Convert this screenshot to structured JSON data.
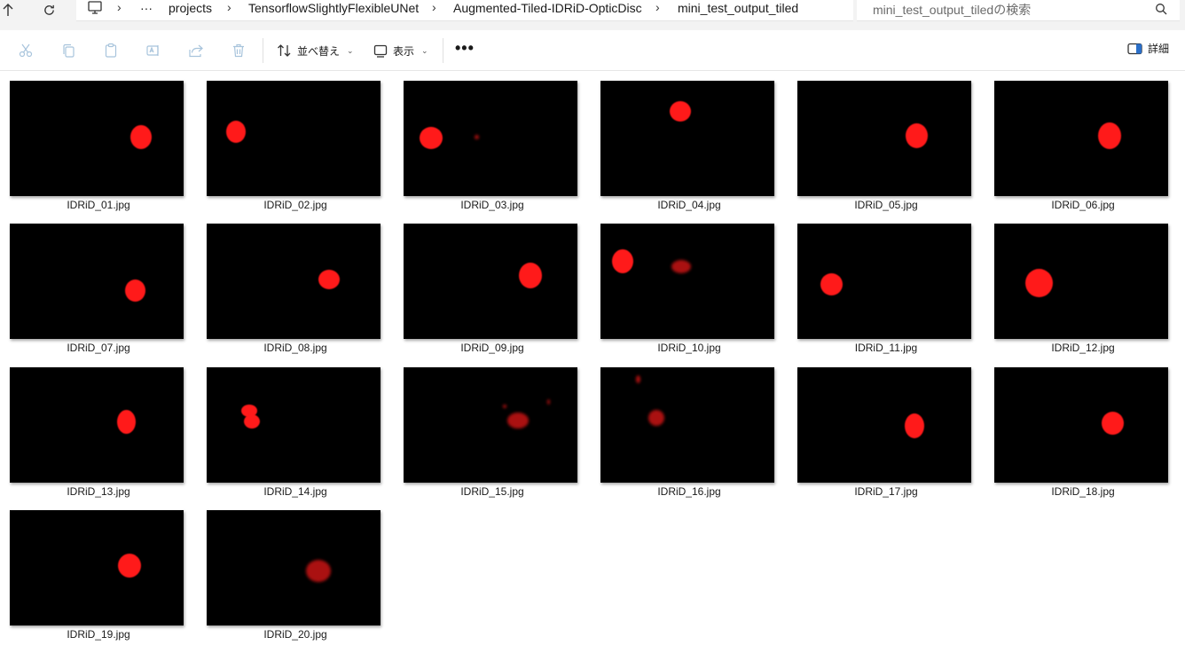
{
  "address": {
    "crumbs": [
      "projects",
      "TensorflowSlightlyFlexibleUNet",
      "Augmented-Tiled-IDRiD-OpticDisc",
      "mini_test_output_tiled"
    ],
    "more_label": "···"
  },
  "search": {
    "placeholder": "mini_test_output_tiledの検索"
  },
  "toolbar": {
    "sort_label": "並べ替え",
    "view_label": "表示",
    "more_label": "•••",
    "details_label": "詳細",
    "icons": [
      "cut-icon",
      "copy-icon",
      "paste-icon",
      "rename-icon",
      "share-icon",
      "delete-icon"
    ]
  },
  "files": [
    {
      "name": "IDRiD_01.jpg"
    },
    {
      "name": "IDRiD_02.jpg"
    },
    {
      "name": "IDRiD_03.jpg"
    },
    {
      "name": "IDRiD_04.jpg"
    },
    {
      "name": "IDRiD_05.jpg"
    },
    {
      "name": "IDRiD_06.jpg"
    },
    {
      "name": "IDRiD_07.jpg"
    },
    {
      "name": "IDRiD_08.jpg"
    },
    {
      "name": "IDRiD_09.jpg"
    },
    {
      "name": "IDRiD_10.jpg"
    },
    {
      "name": "IDRiD_11.jpg"
    },
    {
      "name": "IDRiD_12.jpg"
    },
    {
      "name": "IDRiD_13.jpg"
    },
    {
      "name": "IDRiD_14.jpg"
    },
    {
      "name": "IDRiD_15.jpg"
    },
    {
      "name": "IDRiD_16.jpg"
    },
    {
      "name": "IDRiD_17.jpg"
    },
    {
      "name": "IDRiD_18.jpg"
    },
    {
      "name": "IDRiD_19.jpg"
    },
    {
      "name": "IDRiD_20.jpg"
    }
  ],
  "colors": {
    "mask_red": "#ff1a1a",
    "thumb_bg": "#000000",
    "toolbar_bg": "#ffffff",
    "address_bg": "#f3f3f3"
  }
}
